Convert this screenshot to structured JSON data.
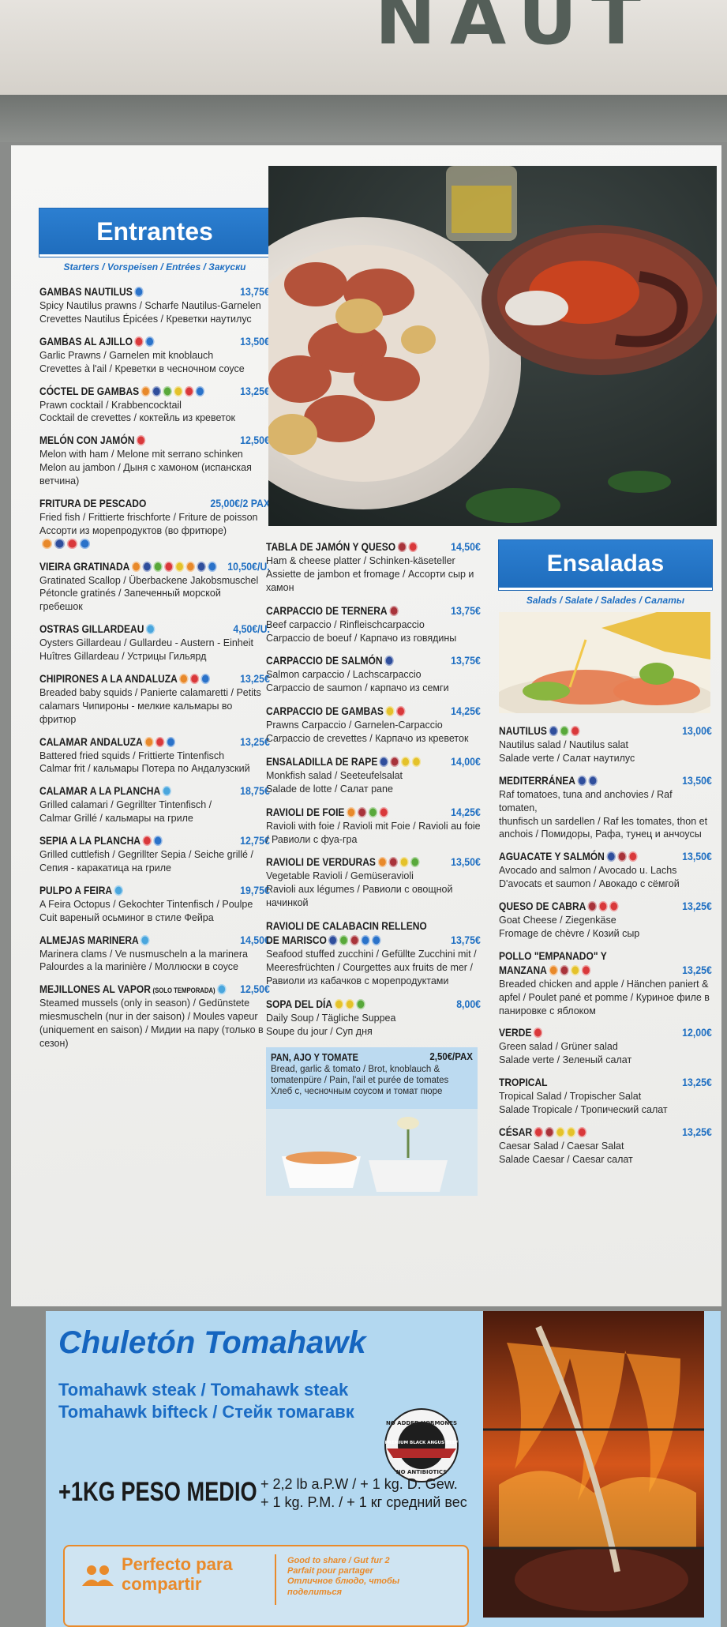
{
  "sign": {
    "text": "NAUT"
  },
  "colors": {
    "heading": "#1f6fc2",
    "price": "#1f6fc2",
    "orange": "#e98a2a"
  },
  "allergen_colors": {
    "blue": "#2a72c9",
    "red": "#d9383a",
    "orange": "#e8892a",
    "green": "#58a83a",
    "yellow": "#e4c22a",
    "navy": "#2f4e9c",
    "lightblue": "#4aa6dd",
    "darkred": "#a8333a"
  },
  "entrantes": {
    "title": "Entrantes",
    "subtitle": "Starters / Vorspeisen / Entrées / Закуски",
    "items": [
      {
        "name": "GAMBAS NAUTILUS",
        "price": "13,75€",
        "allergens": [
          "blue"
        ],
        "desc": [
          "Spicy Nautilus prawns / Scharfe Nautilus-Garnelen",
          "Crevettes Nautilus Épicées / Креветки наутилус"
        ]
      },
      {
        "name": "GAMBAS AL AJILLO",
        "price": "13,50€",
        "allergens": [
          "red",
          "blue"
        ],
        "desc": [
          "Garlic Prawns / Garnelen mit knoblauch",
          "Crevettes à l'ail / Креветки в чесночном соусе"
        ]
      },
      {
        "name": "CÓCTEL DE GAMBAS",
        "price": "13,25€",
        "allergens": [
          "orange",
          "navy",
          "green",
          "yellow",
          "red",
          "blue"
        ],
        "desc": [
          "Prawn cocktail / Krabbencocktail",
          "Cocktail de crevettes / коктейль из креветок"
        ]
      },
      {
        "name": "MELÓN CON JAMÓN",
        "price": "12,50€",
        "allergens": [
          "red"
        ],
        "desc": [
          "Melon with ham / Melone mit serrano schinken",
          "Melon au jambon / Дыня с хамоном (испанская",
          "ветчина)"
        ]
      },
      {
        "name": "FRITURA DE PESCADO",
        "price": "25,00€/2 PAX",
        "allergens": [],
        "desc": [
          "Fried fish / Frittierte frischforte / Friture de poisson",
          "Ассорти из морепродуктов (во фритюре)"
        ],
        "allergens_after": [
          "orange",
          "navy",
          "red",
          "blue"
        ]
      },
      {
        "name": "VIEIRA GRATINADA",
        "price": "10,50€/U.",
        "allergens": [
          "orange",
          "navy",
          "green",
          "red",
          "yellow",
          "orange",
          "navy",
          "blue"
        ],
        "desc": [
          "Gratinated Scallop / Überbackene Jakobsmuschel",
          "Pétoncle gratinés / Запеченный морской",
          "гребешок"
        ]
      },
      {
        "name": "OSTRAS GILLARDEAU",
        "price": "4,50€/U.",
        "allergens": [
          "lightblue"
        ],
        "desc": [
          "Oysters Gillardeau / Gullardeu - Austern - Einheit",
          "Huîtres Gillardeau / Устрицы Гильярд"
        ]
      },
      {
        "name": "CHIPIRONES A LA ANDALUZA",
        "price": "13,25€",
        "allergens": [
          "orange",
          "red",
          "blue"
        ],
        "desc": [
          "Breaded baby squids / Panierte calamaretti / Petits",
          "calamars Чипироны - мелкие кальмары во",
          "фритюр"
        ]
      },
      {
        "name": "CALAMAR ANDALUZA",
        "price": "13,25€",
        "allergens": [
          "orange",
          "red",
          "blue"
        ],
        "desc": [
          "Battered fried squids / Frittierte Tintenfisch",
          "Calmar frit / кальмары Потера по Андалузский"
        ]
      },
      {
        "name": "CALAMAR A LA PLANCHA",
        "price": "18,75€",
        "allergens": [
          "lightblue"
        ],
        "desc": [
          "Grilled calamari / Gegrillter Tintenfisch /",
          "Calmar Grillé / кальмары на гриле"
        ]
      },
      {
        "name": "SEPIA A LA PLANCHA",
        "price": "12,75€",
        "allergens": [
          "red",
          "blue"
        ],
        "desc": [
          "Grilled cuttlefish / Gegrillter Sepia / Seiche grillé /",
          "Сепия - каракатица на гриле"
        ]
      },
      {
        "name": "PULPO A FEIRA",
        "price": "19,75€",
        "allergens": [
          "lightblue"
        ],
        "desc": [
          "A Feira Octopus / Gekochter Tintenfisch / Poulpe",
          "Cuit вареный осьминог в стиле Фейра"
        ]
      },
      {
        "name": "ALMEJAS MARINERA",
        "price": "14,50€",
        "allergens": [
          "lightblue"
        ],
        "desc": [
          "Marinera clams / Ve nusmuscheln a la marinera",
          "Palourdes a la marinière / Моллюски в соусе"
        ]
      },
      {
        "name": "MEJILLONES AL VAPOR",
        "name_suffix": "(SOLO TEMPORADA)",
        "price": "12,50€",
        "allergens": [
          "lightblue"
        ],
        "desc": [
          "Steamed mussels (only in season) / Gedünstete",
          "miesmuscheln (nur in der saison) / Moules vapeur",
          "(uniquement en saison) / Мидии на пару (только в",
          "сезон)"
        ]
      }
    ]
  },
  "middle": {
    "items": [
      {
        "name": "TABLA DE JAMÓN Y QUESO",
        "price": "14,50€",
        "allergens": [
          "darkred",
          "red"
        ],
        "desc": [
          "Ham & cheese platter / Schinken-käseteller",
          "Assiette de jambon et fromage / Ассорти сыр и",
          "хамон"
        ]
      },
      {
        "name": "CARPACCIO DE TERNERA",
        "price": "13,75€",
        "allergens": [
          "darkred"
        ],
        "desc": [
          "Beef carpaccio / Rinfleischcarpaccio",
          "Carpaccio de boeuf / Карпачо из говядины"
        ]
      },
      {
        "name": "CARPACCIO DE SALMÓN",
        "price": "13,75€",
        "allergens": [
          "navy"
        ],
        "desc": [
          "Salmon carpaccio / Lachscarpaccio",
          "Carpaccio de saumon / карпачо из семги"
        ]
      },
      {
        "name": "CARPACCIO DE GAMBAS",
        "price": "14,25€",
        "allergens": [
          "yellow",
          "red"
        ],
        "desc": [
          "Prawns Carpaccio / Garnelen-Carpaccio",
          "Carpaccio de crevettes / Карпачо из креветок"
        ]
      },
      {
        "name": "ENSALADILLA DE RAPE",
        "price": "14,00€",
        "allergens": [
          "navy",
          "darkred",
          "yellow",
          "yellow"
        ],
        "desc": [
          "Monkfish salad / Seeteufelsalat",
          "Salade de lotte / Салат pane"
        ]
      },
      {
        "name": "RAVIOLI DE FOIE",
        "price": "14,25€",
        "allergens": [
          "orange",
          "darkred",
          "green",
          "red"
        ],
        "desc": [
          "Ravioli with foie / Ravioli mit Foie / Ravioli au foie",
          "/ Равиоли с фуа-гра"
        ]
      },
      {
        "name": "RAVIOLI DE VERDURAS",
        "price": "13,50€",
        "allergens": [
          "orange",
          "darkred",
          "yellow",
          "green"
        ],
        "desc": [
          "Vegetable Ravioli / Gemüseravioli",
          "Ravioli aux légumes / Равиоли с овощной",
          "начинкой"
        ]
      },
      {
        "name": "RAVIOLI DE CALABACIN RELLENO",
        "name2": "DE MARISCO",
        "price": "13,75€",
        "allergens": [
          "navy",
          "green",
          "darkred",
          "blue",
          "blue"
        ],
        "desc": [
          "Seafood stuffed zucchini / Gefüllte Zucchini mit /",
          "Meeresfrüchten / Courgettes aux fruits de mer /",
          "Равиоли из кабачков с морепродуктами"
        ]
      },
      {
        "name": "SOPA DEL DÍA",
        "price": "8,00€",
        "allergens": [
          "yellow",
          "yellow",
          "green"
        ],
        "desc": [
          "Daily Soup / Tägliche Suppea",
          "Soupe du jour / Суп дня"
        ]
      }
    ],
    "pan": {
      "name": "PAN, AJO Y TOMATE",
      "price": "2,50€/PAX",
      "desc": [
        "Bread, garlic & tomato / Brot, knoblauch &",
        "tomatenpüre / Pain, l'ail et purée de tomates",
        "Хлеб с, чесночным соусом и томат пюре"
      ]
    }
  },
  "ensaladas": {
    "title": "Ensaladas",
    "subtitle": "Salads / Salate / Salades / Салаты",
    "items": [
      {
        "name": "NAUTILUS",
        "price": "13,00€",
        "allergens": [
          "navy",
          "green",
          "red"
        ],
        "desc": [
          "Nautilus salad / Nautilus salat",
          "Salade verte / Салат наутилус"
        ]
      },
      {
        "name": "MEDITERRÁNEA",
        "price": "13,50€",
        "allergens": [
          "navy",
          "navy"
        ],
        "desc": [
          "Raf tomatoes, tuna and anchovies / Raf tomaten,",
          "thunfisch un sardellen / Raf les tomates, thon et",
          "anchois / Помидоры, Рафа, тунец и анчоусы"
        ]
      },
      {
        "name": "AGUACATE Y SALMÓN",
        "price": "13,50€",
        "allergens": [
          "navy",
          "darkred",
          "red"
        ],
        "desc": [
          "Avocado and salmon / Avocado u. Lachs",
          "D'avocats et saumon / Авокадо с сёмгой"
        ]
      },
      {
        "name": "QUESO DE CABRA",
        "price": "13,25€",
        "allergens": [
          "darkred",
          "red",
          "red"
        ],
        "desc": [
          "Goat Cheese / Ziegenkäse",
          "Fromage de chèvre / Козий сыр"
        ]
      },
      {
        "name": "POLLO \"EMPANADO\" Y",
        "name2": "MANZANA",
        "price": "13,25€",
        "allergens": [
          "orange",
          "darkred",
          "yellow",
          "red"
        ],
        "desc": [
          "Breaded chicken and apple / Hänchen paniert &",
          "apfel / Poulet pané et pomme / Куриное филе в",
          "панировке с яблоком"
        ]
      },
      {
        "name": "VERDE",
        "price": "12,00€",
        "allergens": [
          "red"
        ],
        "desc": [
          "Green salad / Grüner salad",
          "Salade verte / Зеленый салат"
        ]
      },
      {
        "name": "TROPICAL",
        "price": "13,25€",
        "allergens": [],
        "desc": [
          "Tropical Salad / Tropischer Salat",
          "Salade Tropicale / Тропический салат"
        ]
      },
      {
        "name": "CÉSAR",
        "price": "13,25€",
        "allergens": [
          "red",
          "darkred",
          "yellow",
          "yellow",
          "red"
        ],
        "desc": [
          "Caesar Salad / Caesar Salat",
          "Salade Caesar / Caesar салат"
        ]
      }
    ]
  },
  "tomahawk": {
    "title": "Chuletón Tomahawk",
    "sub1": "Tomahawk steak / Tomahawk steak",
    "sub2": "Tomahawk bifteck / Стейк томагавк",
    "peso": "+1KG PESO MEDIO",
    "peso_alt1": "+ 2,2 lb a.P.W / + 1 kg. D. Gew.",
    "peso_alt2": "+ 1 kg. P.M. / + 1 кг средний вес",
    "badge_top": "NO ADDED HORMONES",
    "badge_mid": "PREMIUM BLACK ANGUS BEEF",
    "badge_bottom": "NO ANTIBIOTICS",
    "share_title1": "Perfecto para",
    "share_title2": "compartir",
    "share_desc": [
      "Good to share / Gut fur 2",
      "Parfait pour partager",
      "Отличное блюдо, чтобы",
      "поделиться"
    ]
  }
}
